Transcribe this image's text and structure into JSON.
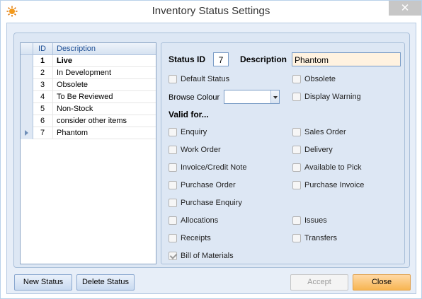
{
  "window": {
    "title": "Inventory Status Settings",
    "close_glyph": "✕"
  },
  "grid": {
    "columns": {
      "id": "ID",
      "description": "Description"
    },
    "rows": [
      {
        "id": "1",
        "description": "Live"
      },
      {
        "id": "2",
        "description": "In Development"
      },
      {
        "id": "3",
        "description": "Obsolete"
      },
      {
        "id": "4",
        "description": "To Be Reviewed"
      },
      {
        "id": "5",
        "description": "Non-Stock"
      },
      {
        "id": "6",
        "description": "consider other items"
      },
      {
        "id": "7",
        "description": "Phantom"
      }
    ]
  },
  "detail": {
    "status_id_label": "Status ID",
    "status_id_value": "7",
    "description_label": "Description",
    "description_value": "Phantom",
    "default_status": "Default Status",
    "obsolete": "Obsolete",
    "browse_colour": "Browse Colour",
    "display_warning": "Display Warning",
    "valid_for": "Valid for...",
    "checks": {
      "enquiry": "Enquiry",
      "sales_order": "Sales Order",
      "work_order": "Work Order",
      "delivery": "Delivery",
      "invoice_credit_note": "Invoice/Credit Note",
      "available_to_pick": "Available to Pick",
      "purchase_order": "Purchase Order",
      "purchase_invoice": "Purchase Invoice",
      "purchase_enquiry": "Purchase Enquiry",
      "allocations": "Allocations",
      "issues": "Issues",
      "receipts": "Receipts",
      "transfers": "Transfers",
      "bill_of_materials": "Bill of Materials"
    }
  },
  "buttons": {
    "new_status": "New Status",
    "delete_status": "Delete Status",
    "accept": "Accept",
    "close": "Close"
  },
  "colors": {
    "accent": "#f7b552",
    "description_field": "#fff2e0",
    "header_text": "#1c4d94"
  }
}
